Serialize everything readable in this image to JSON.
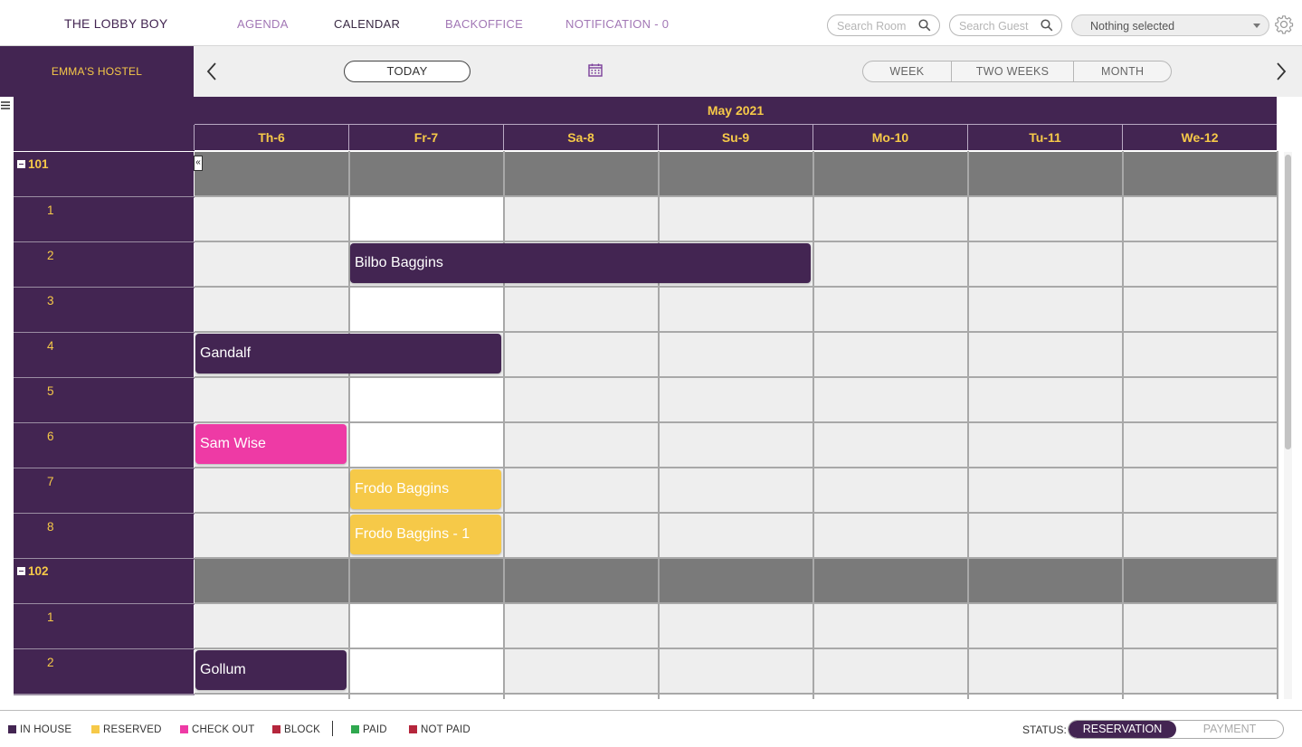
{
  "brand": {
    "logo_text": "THE LOBBY BOY"
  },
  "nav": {
    "items": [
      {
        "label": "AGENDA",
        "active": false
      },
      {
        "label": "CALENDAR",
        "active": true
      },
      {
        "label": "BACKOFFICE",
        "active": false
      },
      {
        "label": "NOTIFICATION - 0",
        "active": false
      }
    ]
  },
  "search": {
    "room_placeholder": "Search Room",
    "guest_placeholder": "Search Guest",
    "select_value": "Nothing selected"
  },
  "toolbar": {
    "hostel_name": "EMMA'S HOSTEL",
    "today_label": "TODAY",
    "ranges": [
      "WEEK",
      "TWO WEEKS",
      "MONTH"
    ]
  },
  "calendar": {
    "month_label": "May 2021",
    "days": [
      "Th-6",
      "Fr-7",
      "Sa-8",
      "Su-9",
      "Mo-10",
      "Tu-11",
      "We-12"
    ],
    "expand_symbol": "«",
    "rows": [
      {
        "label": "101",
        "group": true
      },
      {
        "label": "1",
        "group": false
      },
      {
        "label": "2",
        "group": false
      },
      {
        "label": "3",
        "group": false
      },
      {
        "label": "4",
        "group": false
      },
      {
        "label": "5",
        "group": false
      },
      {
        "label": "6",
        "group": false
      },
      {
        "label": "7",
        "group": false
      },
      {
        "label": "8",
        "group": false
      },
      {
        "label": "102",
        "group": true
      },
      {
        "label": "1",
        "group": false
      },
      {
        "label": "2",
        "group": false
      }
    ],
    "bookings": [
      {
        "guest": "Bilbo Baggins",
        "row": 2,
        "start_day": 1,
        "span": 3,
        "status": "inhouse"
      },
      {
        "guest": "Gandalf",
        "row": 4,
        "start_day": 0,
        "span": 2,
        "status": "inhouse"
      },
      {
        "guest": "Sam Wise",
        "row": 6,
        "start_day": 0,
        "span": 1,
        "status": "checkout"
      },
      {
        "guest": "Frodo Baggins",
        "row": 7,
        "start_day": 1,
        "span": 1,
        "status": "reserved"
      },
      {
        "guest": "Frodo Baggins - 1",
        "row": 8,
        "start_day": 1,
        "span": 1,
        "status": "reserved"
      },
      {
        "guest": "Gollum",
        "row": 11,
        "start_day": 0,
        "span": 1,
        "status": "inhouse"
      }
    ]
  },
  "legend": {
    "items": [
      {
        "label": "IN HOUSE",
        "color": "#432552"
      },
      {
        "label": "RESERVED",
        "color": "#f6c948"
      },
      {
        "label": "CHECK OUT",
        "color": "#ee3aa5"
      },
      {
        "label": "BLOCK",
        "color": "#b5263c"
      },
      {
        "label": "PAID",
        "color": "#2fa84f"
      },
      {
        "label": "NOT PAID",
        "color": "#b5263c"
      }
    ],
    "status_label": "STATUS:",
    "status_options": [
      "RESERVATION",
      "PAYMENT"
    ],
    "status_active": "RESERVATION"
  },
  "colors": {
    "primary": "#432552",
    "accent": "#f6c948",
    "nav_link": "#a277b5",
    "checkout": "#ee3aa5"
  }
}
